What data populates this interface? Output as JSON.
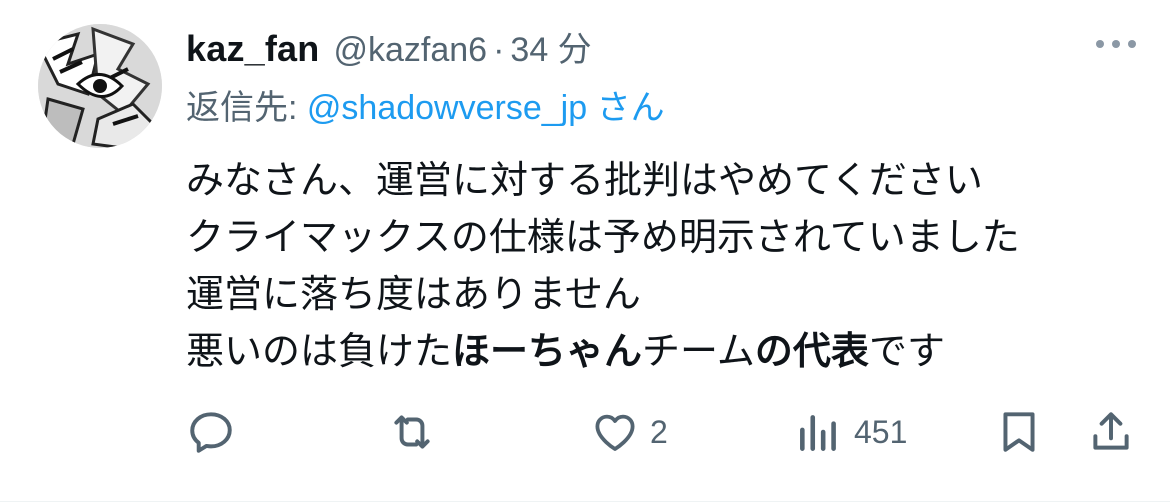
{
  "tweet": {
    "display_name": "kaz_fan",
    "handle": "@kazfan6",
    "separator": "·",
    "time": "34 分",
    "reply_prefix": "返信先: ",
    "reply_mention": "@shadowverse_jp",
    "reply_suffix": " さん",
    "body": {
      "line1": "みなさん、運営に対する批判はやめてください",
      "line2": "クライマックスの仕様は予め明示されていました",
      "line3": "運営に落ち度はありません",
      "line4_a": "悪いのは負けた",
      "line4_b": "ほーちゃん",
      "line4_c": "チーム",
      "line4_d": "の",
      "line4_e": "代表",
      "line4_f": "です"
    }
  },
  "actions": {
    "reply": {
      "icon": "reply-icon",
      "count": ""
    },
    "repost": {
      "icon": "repost-icon",
      "count": ""
    },
    "like": {
      "icon": "heart-icon",
      "count": "2"
    },
    "views": {
      "icon": "views-icon",
      "count": "451"
    },
    "bookmark": {
      "icon": "bookmark-icon"
    },
    "share": {
      "icon": "share-icon"
    }
  },
  "colors": {
    "text": "#0f1419",
    "secondary": "#536471",
    "link": "#1d9bf0",
    "icon": "#536471"
  }
}
